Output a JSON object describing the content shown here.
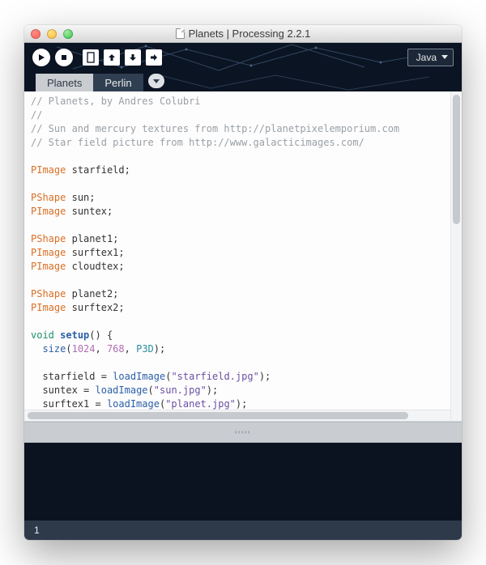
{
  "window": {
    "title": "Planets | Processing 2.2.1"
  },
  "toolbar": {
    "run_label": "Run",
    "stop_label": "Stop",
    "new_label": "New",
    "open_label": "Open",
    "save_label": "Save",
    "export_label": "Export"
  },
  "mode_selector": {
    "selected": "Java"
  },
  "tabs": [
    {
      "label": "Planets",
      "active": true
    },
    {
      "label": "Perlin",
      "active": false
    }
  ],
  "code": {
    "c1": "// Planets, by Andres Colubri",
    "c2": "//",
    "c3": "// Sun and mercury textures from http://planetpixelemporium.com",
    "c4": "// Star field picture from http://www.galacticimages.com/",
    "t_pimage": "PImage",
    "t_pshape": "PShape",
    "kw_void": "void",
    "fn_setup": "setup",
    "call_size": "size",
    "call_loadImage": "loadImage",
    "const_p3d": "P3D",
    "v_starfield": "starfield",
    "v_sun": "sun",
    "v_suntex": "suntex",
    "v_planet1": "planet1",
    "v_surftex1": "surftex1",
    "v_cloudtex": "cloudtex",
    "v_planet2": "planet2",
    "v_surftex2": "surftex2",
    "n_1024": "1024",
    "n_768": "768",
    "s_starfield": "\"starfield.jpg\"",
    "s_sun": "\"sun.jpg\"",
    "s_planet": "\"planet.jpg\"",
    "semi": ";",
    "eq": " = ",
    "sp": " ",
    "op_paren_open": "(",
    "op_paren_close": ")",
    "op_brace_open": " {",
    "comma_sp": ", ",
    "indent2": "  "
  },
  "status": {
    "line_number": "1"
  }
}
